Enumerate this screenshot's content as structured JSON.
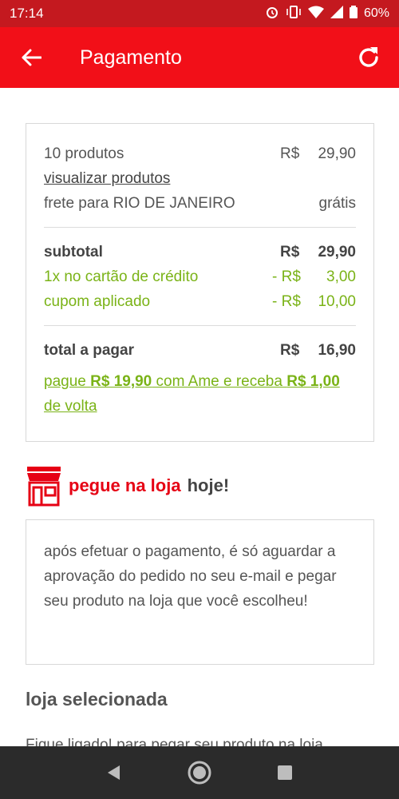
{
  "status": {
    "time": "17:14",
    "battery": "60%"
  },
  "appbar": {
    "title": "Pagamento"
  },
  "summary": {
    "products_label": "10 produtos",
    "products_currency": "R$",
    "products_value": "29,90",
    "view_products": "visualizar produtos",
    "shipping_label": "frete para RIO DE JANEIRO",
    "shipping_value": "grátis",
    "subtotal_label": "subtotal",
    "subtotal_currency": "R$",
    "subtotal_value": "29,90",
    "card_label": "1x no cartão de crédito",
    "card_currency": "- R$",
    "card_value": "3,00",
    "coupon_label": "cupom aplicado",
    "coupon_currency": "- R$",
    "coupon_value": "10,00",
    "total_label": "total a pagar",
    "total_currency": "R$",
    "total_value": "16,90",
    "ame_part1": "pague ",
    "ame_amount1": "R$ 19,90",
    "ame_part2": " com Ame e receba ",
    "ame_amount2": "R$ 1,00",
    "ame_part3": " de volta"
  },
  "pickup": {
    "title_highlight": "pegue na loja",
    "title_rest": "hoje!",
    "info": "após efetuar o pagamento, é só aguardar a aprovação do pedido no seu e-mail e pegar seu produto na loja que você escolheu!"
  },
  "store": {
    "title": "loja selecionada",
    "text": "Fique ligado! para pegar seu produto na loja"
  },
  "colors": {
    "brand_red": "#f20f18",
    "status_red": "#c4191f",
    "green": "#7ab317"
  }
}
